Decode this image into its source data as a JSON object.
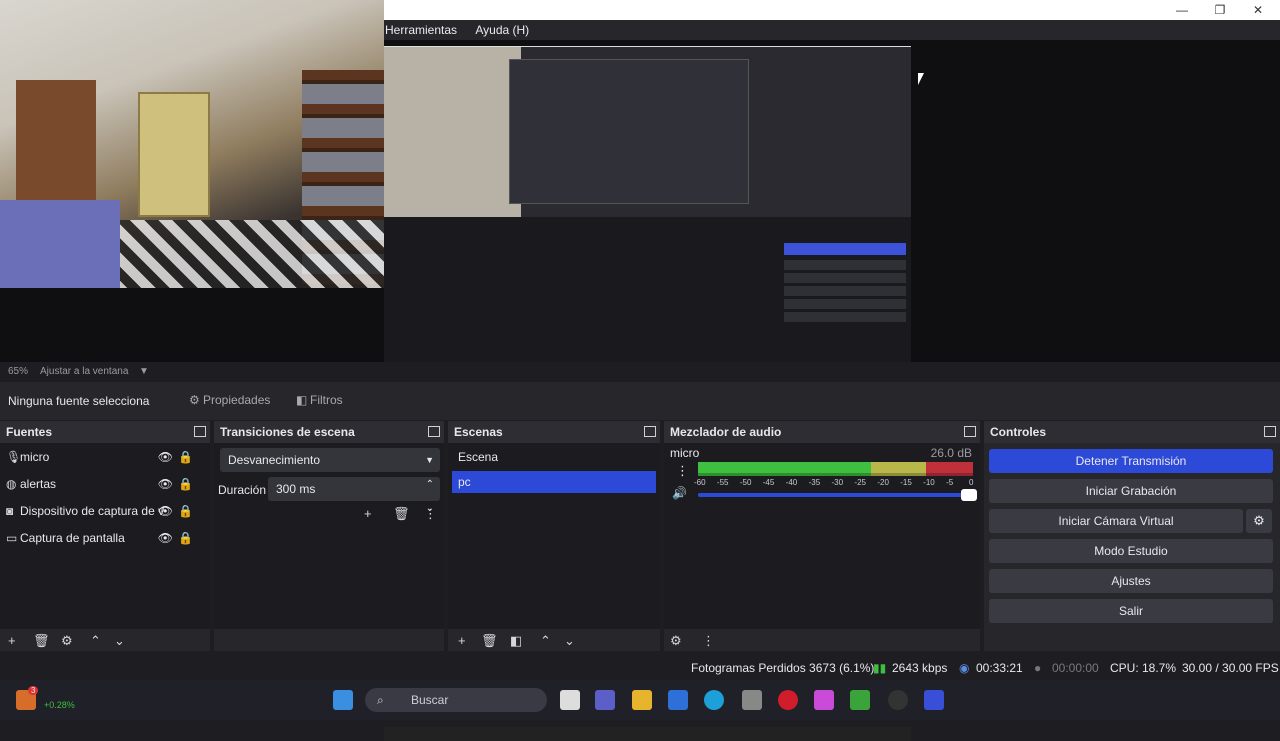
{
  "menu": {
    "items": [
      "Herramientas",
      "Ayuda (H)"
    ]
  },
  "preview": {
    "zoom": "65%",
    "fit_label": "Ajustar a la ventana"
  },
  "source_toolbar": {
    "none_selected": "Ninguna fuente selecciona",
    "properties": "Propiedades",
    "filters": "Filtros"
  },
  "sources": {
    "title": "Fuentes",
    "items": [
      {
        "label": "micro",
        "icon": "microphone-icon"
      },
      {
        "label": "alertas",
        "icon": "globe-icon"
      },
      {
        "label": "Dispositivo de captura de v",
        "icon": "camera-icon"
      },
      {
        "label": "Captura de pantalla",
        "icon": "monitor-icon"
      }
    ]
  },
  "transitions": {
    "title": "Transiciones de escena",
    "selected": "Desvanecimiento",
    "duration_label": "Duración",
    "duration_value": "300 ms"
  },
  "scenes": {
    "title": "Escenas",
    "items": [
      "Escena",
      "pc"
    ],
    "selected_index": 1
  },
  "mixer": {
    "title": "Mezclador de audio",
    "channel": "micro",
    "db": "26.0 dB",
    "scale": [
      "-60",
      "-55",
      "-50",
      "-45",
      "-40",
      "-35",
      "-30",
      "-25",
      "-20",
      "-15",
      "-10",
      "-5",
      "0"
    ],
    "volume_fraction": 1.0
  },
  "controls": {
    "title": "Controles",
    "stop_stream": "Detener Transmisión",
    "start_recording": "Iniciar Grabación",
    "start_virtual_cam": "Iniciar Cámara Virtual",
    "studio_mode": "Modo Estudio",
    "settings": "Ajustes",
    "exit": "Salir"
  },
  "status": {
    "dropped_frames": "Fotogramas Perdidos 3673 (6.1%)",
    "bitrate": "2643 kbps",
    "stream_time": "00:33:21",
    "rec_time": "00:00:00",
    "cpu": "CPU: 18.7%",
    "fps": "30.00 / 30.00 FPS"
  },
  "taskbar": {
    "search_placeholder": "Buscar",
    "weather_badge": "3",
    "stock_change": "+0.28%"
  },
  "colors": {
    "accent": "#2c49d8",
    "panel": "#26262b",
    "meter_green": "#3fbf3f",
    "meter_yellow": "#b8b84a",
    "meter_red": "#c0303a"
  }
}
